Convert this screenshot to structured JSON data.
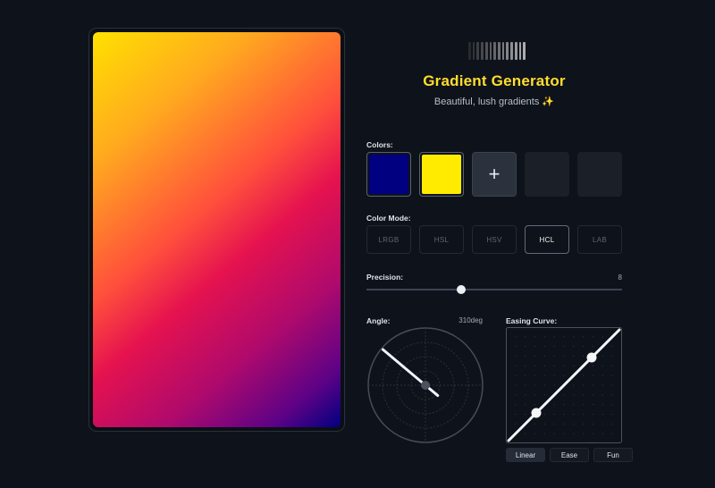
{
  "app": {
    "title": "Gradient Generator",
    "subtitle": "Beautiful, lush gradients ✨"
  },
  "colors": {
    "label": "Colors:",
    "swatches": [
      "#000080",
      "#ffeb00"
    ],
    "add_label": "+",
    "empty_slots": 2
  },
  "color_mode": {
    "label": "Color Mode:",
    "options": [
      "LRGB",
      "HSL",
      "HSV",
      "HCL",
      "LAB"
    ],
    "selected": "HCL"
  },
  "precision": {
    "label": "Precision:",
    "value": "8",
    "fraction": 0.37
  },
  "angle": {
    "label": "Angle:",
    "value_text": "310deg",
    "degrees": 310
  },
  "easing": {
    "label": "Easing Curve:",
    "control_points": [
      [
        0.25,
        0.25
      ],
      [
        0.75,
        0.75
      ]
    ],
    "buttons": [
      "Linear",
      "Ease",
      "Fun"
    ],
    "selected": "Linear"
  },
  "preview": {
    "stops": [
      "#ffe100",
      "#ff4f3c",
      "#e5124f",
      "#5e0286",
      "#000080"
    ]
  },
  "colors_theme": {
    "accent": "#ffde2e",
    "background": "#0e121a"
  }
}
